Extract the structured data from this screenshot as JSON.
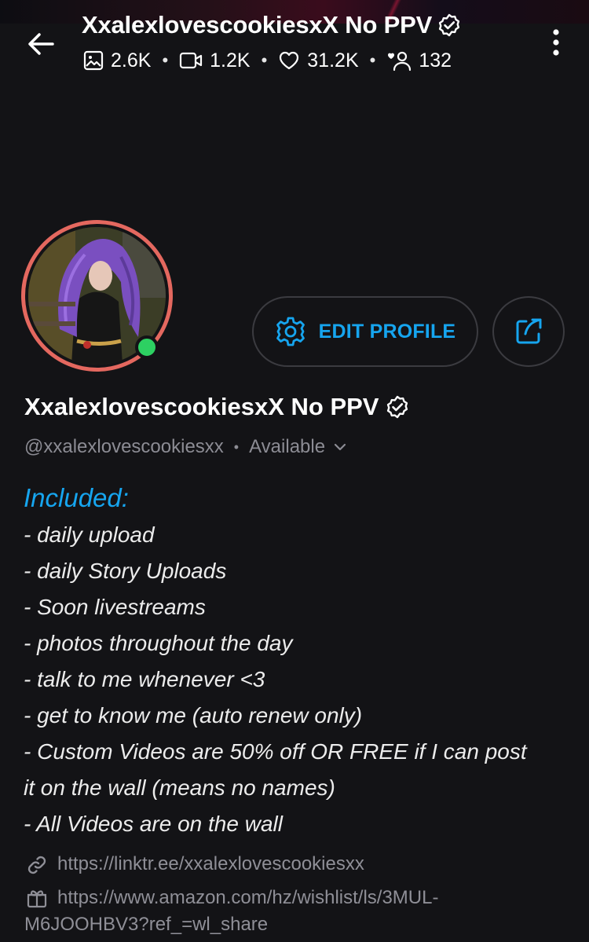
{
  "header": {
    "title": "XxalexlovescookiesxX No PPV",
    "verified_icon": "verified-badge-icon",
    "stats": {
      "photos": "2.6K",
      "videos": "1.2K",
      "likes": "31.2K",
      "fans": "132"
    }
  },
  "profile": {
    "display_name": "XxalexlovescookiesxX No PPV",
    "handle": "@xxalexlovescookiesxx",
    "status": "Available",
    "online": true
  },
  "actions": {
    "edit_profile_label": "EDIT PROFILE"
  },
  "bio": {
    "heading": "Included:",
    "lines": [
      "- daily upload",
      "- daily Story Uploads",
      "- Soon livestreams",
      "- photos throughout the day",
      "- talk to me whenever <3",
      "- get to know me (auto renew only)",
      "- Custom Videos are 50% off OR FREE if I can post",
      "it on the wall (means no names)",
      "- All Videos are on the wall"
    ]
  },
  "links": {
    "linktree": "https://linktr.ee/xxalexlovescookiesxx",
    "wishlist_line1": "https://www.amazon.com/hz/wishlist/ls/3MUL-",
    "wishlist_line2": "M6JOOHBV3?ref_=wl_share"
  },
  "colors": {
    "background": "#131316",
    "accent": "#16a5ef",
    "online": "#2dd062",
    "avatar_ring": "#e4685f",
    "muted_text": "#8c8c94"
  }
}
